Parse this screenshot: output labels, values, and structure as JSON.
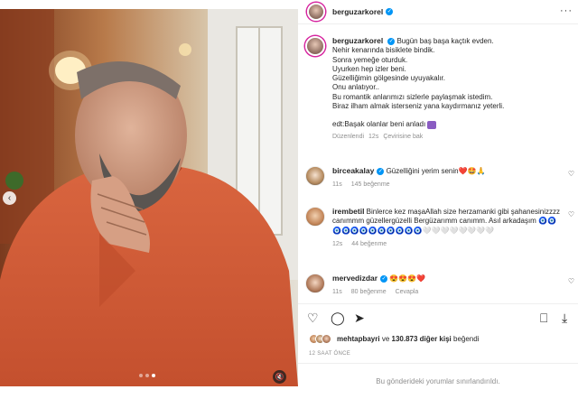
{
  "post": {
    "username": "berguzarkorel",
    "caption_lines": [
      "Bugün baş başa kaçtık evden.",
      "Nehir kenarında bisiklete bindik.",
      "Sonra yemeğe oturduk.",
      "Uyurken hep izler beni.",
      "Güzelliğimin gölgesinde uyuyakalır.",
      "Onu anlatıyor..",
      "Bu romantik anlarımızı sizlerle paylaşmak istedim.",
      "Biraz ilham almak isterseniz yana kaydırmanız yeterli."
    ],
    "edit_note": "edt:Başak olanlar beni anladı",
    "edited_label": "Düzenlendi",
    "age": "12s",
    "translate_label": "Çevirisine bak"
  },
  "comments": [
    {
      "username": "birceakalay",
      "verified": true,
      "text": "Güzelliğini yerim senin❤️🤩🙏",
      "age": "11s",
      "likes": "145 beğenme",
      "reply": ""
    },
    {
      "username": "irembetil",
      "verified": false,
      "text": "Binlerce kez maşaAllah size herzamanki gibi şahanesinizzzz canımmm güzellergüzelli Bergüzarımm canımm. Asıl arkadaşım 🧿🧿🧿🧿🧿🧿🧿🧿🧿🧿🧿🧿🤍🤍🤍🤍🤍🤍🤍🤍",
      "age": "12s",
      "likes": "44 beğenme",
      "reply": ""
    },
    {
      "username": "mervedizdar",
      "verified": true,
      "text": "😍😍😍❤️",
      "age": "11s",
      "likes": "80 beğenme",
      "reply": "Cevapla"
    }
  ],
  "likes": {
    "first_liker": "mehtapbayri",
    "connector": "ve",
    "others": "130.873 diğer kişi",
    "suffix": "beğendi"
  },
  "time_label": "12 SAAT ÖNCE",
  "comments_limited": "Bu gönderideki yorumlar sınırlandırıldı.",
  "icons": {
    "more": "···",
    "heart": "♡",
    "comment": "◯",
    "share": "➤",
    "save": "⎕",
    "download": "⤓",
    "prev": "‹",
    "mute": "🔇"
  },
  "colors": {
    "accent": "#0095f6",
    "story_ring": "#d6249f",
    "muted_text": "#8e8e8e"
  },
  "carousel": {
    "slides": 3,
    "active": 3
  }
}
